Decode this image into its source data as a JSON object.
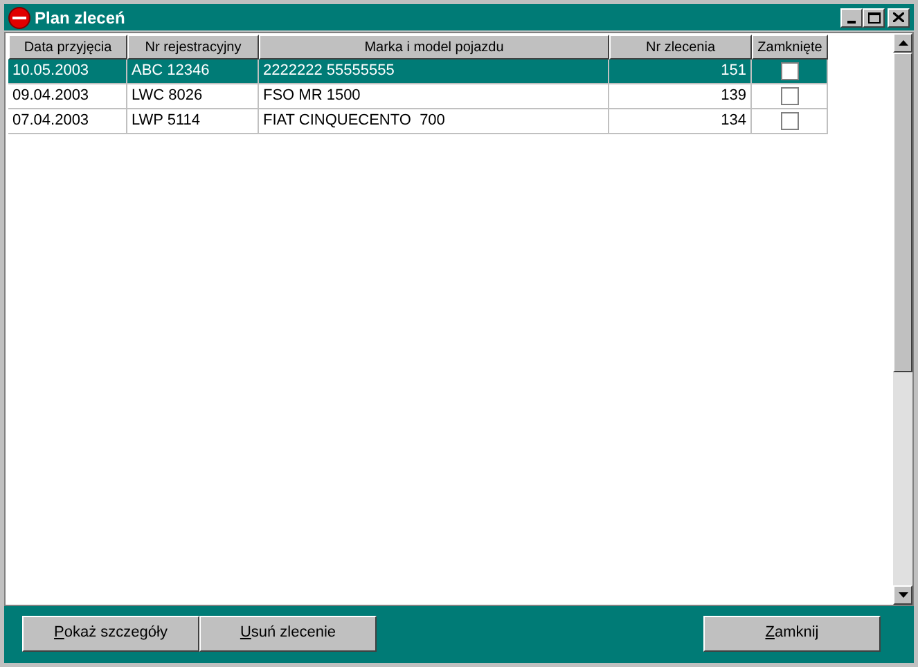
{
  "window": {
    "title": "Plan zleceń"
  },
  "table": {
    "columns": [
      "Data przyjęcia",
      "Nr rejestracyjny",
      "Marka i model pojazdu",
      "Nr zlecenia",
      "Zamknięte"
    ],
    "rows": [
      {
        "date": "10.05.2003",
        "registration": "ABC 12346",
        "vehicle": "2222222 55555555",
        "order_no": "151",
        "closed": false,
        "selected": true
      },
      {
        "date": "09.04.2003",
        "registration": "LWC 8026",
        "vehicle": "FSO MR 1500",
        "order_no": "139",
        "closed": false,
        "selected": false
      },
      {
        "date": "07.04.2003",
        "registration": "LWP 5114",
        "vehicle": "FIAT CINQUECENTO  700",
        "order_no": "134",
        "closed": false,
        "selected": false
      }
    ]
  },
  "buttons": [
    {
      "label": "Pokaż szczegóły",
      "underline_first": true
    },
    {
      "label": "Usuń zlecenie",
      "underline_first": true
    },
    {
      "label": "Zamknij",
      "underline_first": true
    }
  ]
}
